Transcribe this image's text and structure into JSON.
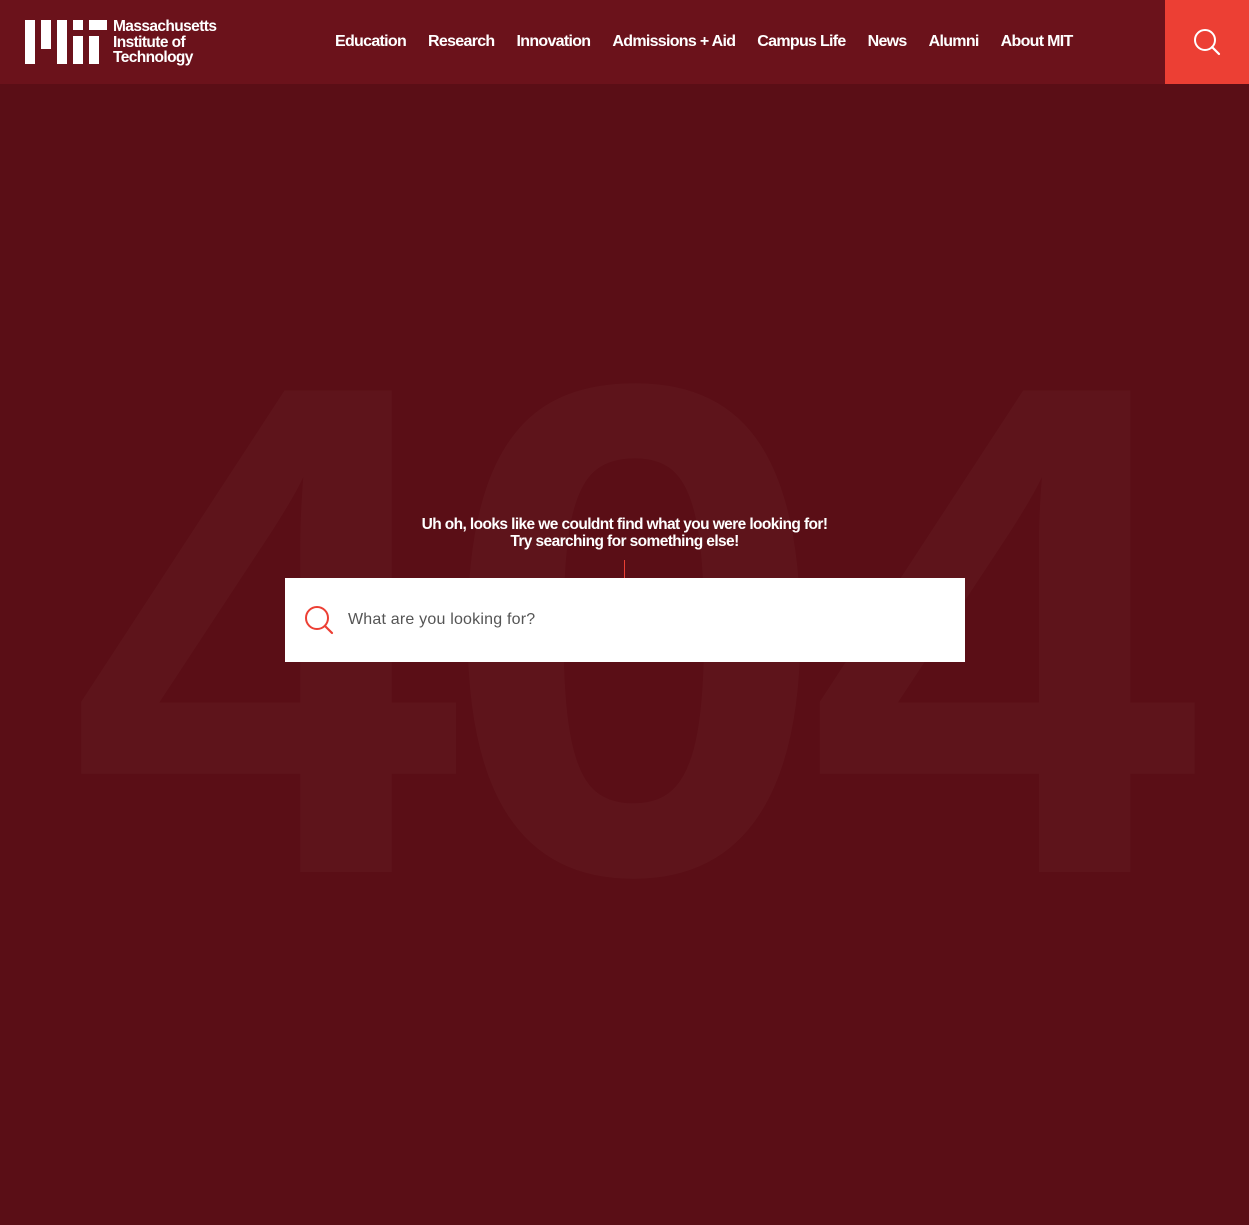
{
  "header": {
    "logo": {
      "line1": "Massachusetts",
      "line2": "Institute of",
      "line3": "Technology"
    },
    "nav": [
      {
        "label": "Education"
      },
      {
        "label": "Research"
      },
      {
        "label": "Innovation"
      },
      {
        "label": "Admissions + Aid"
      },
      {
        "label": "Campus Life"
      },
      {
        "label": "News"
      },
      {
        "label": "Alumni"
      },
      {
        "label": "About MIT"
      }
    ],
    "search_icon": "search-icon"
  },
  "main": {
    "big_code": "404",
    "message_line1": "Uh oh, looks like we couldnt find what you were looking for!",
    "message_line2": "Try searching for something else!",
    "search": {
      "placeholder": "What are you looking for?",
      "value": "",
      "icon": "search-icon"
    }
  },
  "colors": {
    "background": "#5a0e16",
    "header": "#6b121b",
    "accent": "#ec3f34",
    "text": "#ffffff"
  }
}
